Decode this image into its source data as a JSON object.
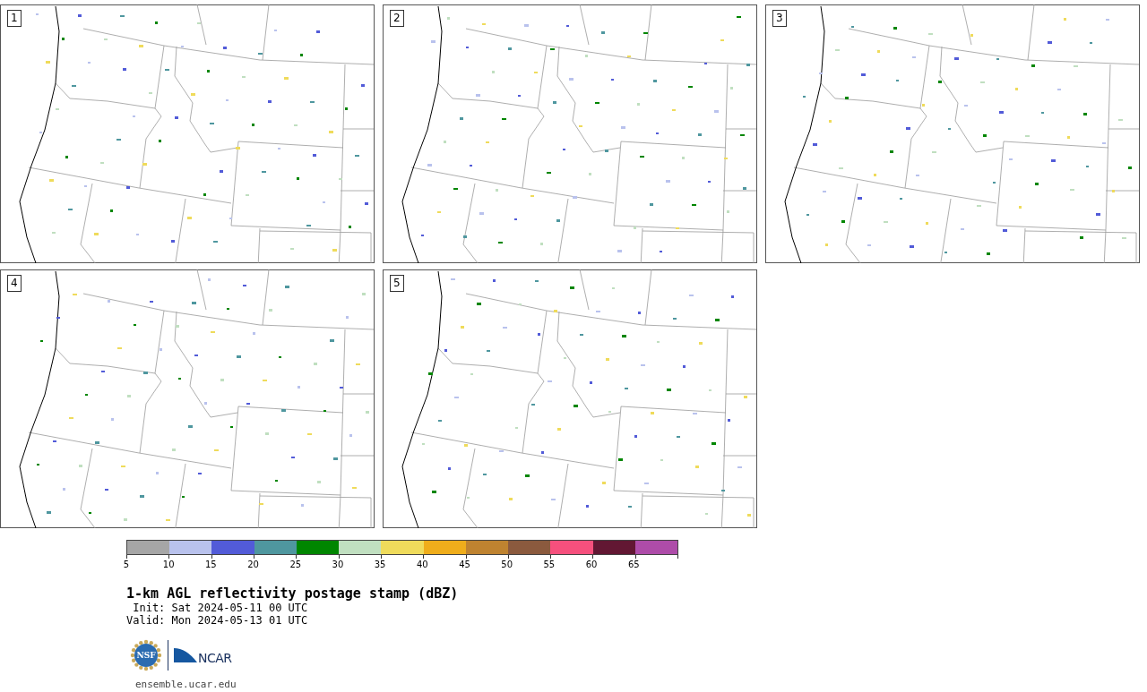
{
  "panels": [
    {
      "label": "1"
    },
    {
      "label": "2"
    },
    {
      "label": "3"
    },
    {
      "label": "4"
    },
    {
      "label": "5"
    }
  ],
  "colorbar": {
    "segments": [
      {
        "tick": "5",
        "color": "#a6a6a6"
      },
      {
        "tick": "10",
        "color": "#b9c2ed"
      },
      {
        "tick": "15",
        "color": "#525bd8"
      },
      {
        "tick": "20",
        "color": "#4f979f"
      },
      {
        "tick": "25",
        "color": "#008600"
      },
      {
        "tick": "30",
        "color": "#c0dfc0"
      },
      {
        "tick": "35",
        "color": "#efdb5b"
      },
      {
        "tick": "40",
        "color": "#efad1b"
      },
      {
        "tick": "45",
        "color": "#bf8330"
      },
      {
        "tick": "50",
        "color": "#8b5a3e"
      },
      {
        "tick": "55",
        "color": "#f6507d"
      },
      {
        "tick": "60",
        "color": "#621733"
      },
      {
        "tick": "65",
        "color": "#ae4ca9"
      }
    ]
  },
  "title": "1-km AGL reflectivity postage stamp (dBZ)",
  "init": " Init: Sat 2024-05-11 00 UTC",
  "valid": "Valid: Mon 2024-05-13 01 UTC",
  "logos": {
    "nsf": "NSF",
    "ncar": "NCAR"
  },
  "footer": "ensemble.ucar.edu"
}
